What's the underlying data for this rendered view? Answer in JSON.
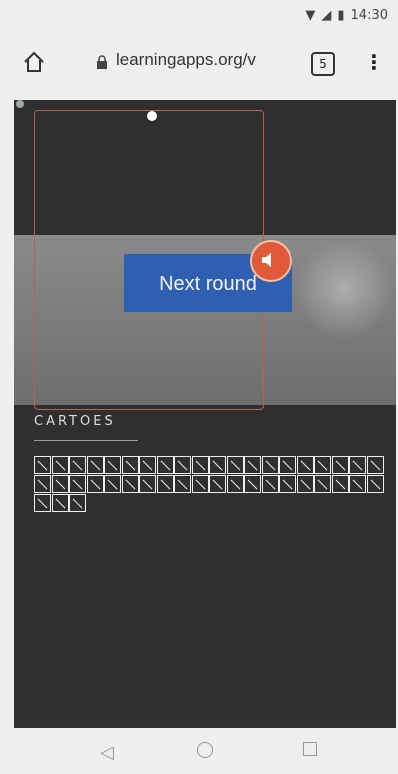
{
  "status_bar": {
    "time": "14:30"
  },
  "browser": {
    "url": "learningapps.org/v",
    "tab_count": "5",
    "menu_icon": "kebab-menu-icon"
  },
  "app": {
    "next_round_label": "Next round",
    "section_label": "CARTOES",
    "card_count": 43
  },
  "nav_bar": {
    "back_icon": "triangle-back-icon",
    "home_icon": "circle-home-icon",
    "recents_icon": "square-recents-icon"
  }
}
